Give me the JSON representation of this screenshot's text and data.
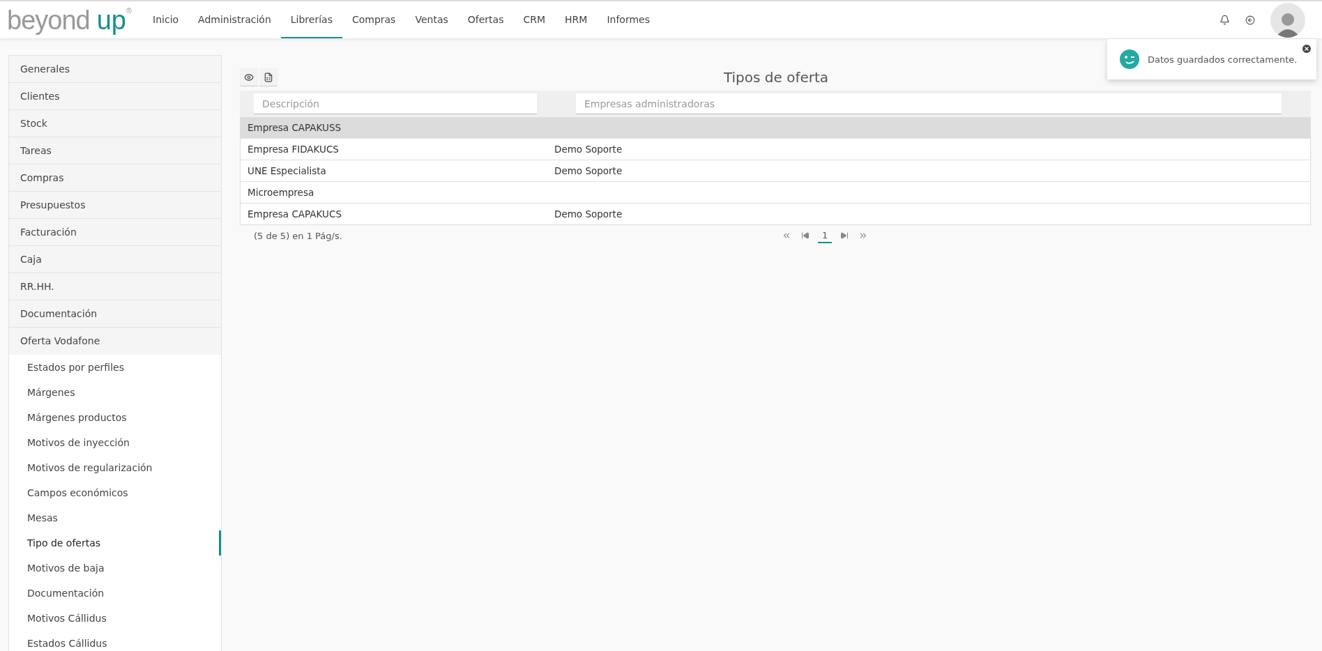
{
  "logo": {
    "word1": "beyond",
    "word2": "up",
    "mark": "®"
  },
  "nav": [
    {
      "label": "Inicio",
      "selected": false
    },
    {
      "label": "Administración",
      "selected": false
    },
    {
      "label": "Librerías",
      "selected": true
    },
    {
      "label": "Compras",
      "selected": false
    },
    {
      "label": "Ventas",
      "selected": false
    },
    {
      "label": "Ofertas",
      "selected": false
    },
    {
      "label": "CRM",
      "selected": false
    },
    {
      "label": "HRM",
      "selected": false
    },
    {
      "label": "Informes",
      "selected": false
    }
  ],
  "toast": {
    "message": "Datos guardados correctamente."
  },
  "sidebar": {
    "items": [
      {
        "label": "Generales"
      },
      {
        "label": "Clientes"
      },
      {
        "label": "Stock"
      },
      {
        "label": "Tareas"
      },
      {
        "label": "Compras"
      },
      {
        "label": "Presupuestos"
      },
      {
        "label": "Facturación"
      },
      {
        "label": "Caja"
      },
      {
        "label": "RR.HH."
      },
      {
        "label": "Documentación"
      },
      {
        "label": "Oferta Vodafone",
        "expanded": true,
        "children": [
          {
            "label": "Estados por perfiles",
            "selected": false
          },
          {
            "label": "Márgenes",
            "selected": false
          },
          {
            "label": "Márgenes productos",
            "selected": false
          },
          {
            "label": "Motivos de inyección",
            "selected": false
          },
          {
            "label": "Motivos de regularización",
            "selected": false
          },
          {
            "label": "Campos económicos",
            "selected": false
          },
          {
            "label": "Mesas",
            "selected": false
          },
          {
            "label": "Tipo de ofertas",
            "selected": true
          },
          {
            "label": "Motivos de baja",
            "selected": false
          },
          {
            "label": "Documentación",
            "selected": false
          },
          {
            "label": "Motivos Cállidus",
            "selected": false
          },
          {
            "label": "Estados Cállidus",
            "selected": false
          }
        ]
      }
    ]
  },
  "page_title": "Tipos de oferta",
  "table": {
    "filters": [
      {
        "placeholder": "Descripción"
      },
      {
        "placeholder": "Empresas administradoras"
      }
    ],
    "rows": [
      {
        "cells": [
          "Empresa CAPAKUSS",
          ""
        ],
        "selected": true
      },
      {
        "cells": [
          "Empresa FIDAKUCS",
          "Demo Soporte"
        ],
        "selected": false
      },
      {
        "cells": [
          "UNE Especialista",
          "Demo Soporte"
        ],
        "selected": false
      },
      {
        "cells": [
          "Microempresa",
          ""
        ],
        "selected": false
      },
      {
        "cells": [
          "Empresa CAPAKUCS",
          "Demo Soporte"
        ],
        "selected": false
      }
    ]
  },
  "footer": {
    "summary": "(5 de 5) en 1 Pág/s.",
    "pages": [
      {
        "label": "1",
        "selected": true
      }
    ]
  }
}
